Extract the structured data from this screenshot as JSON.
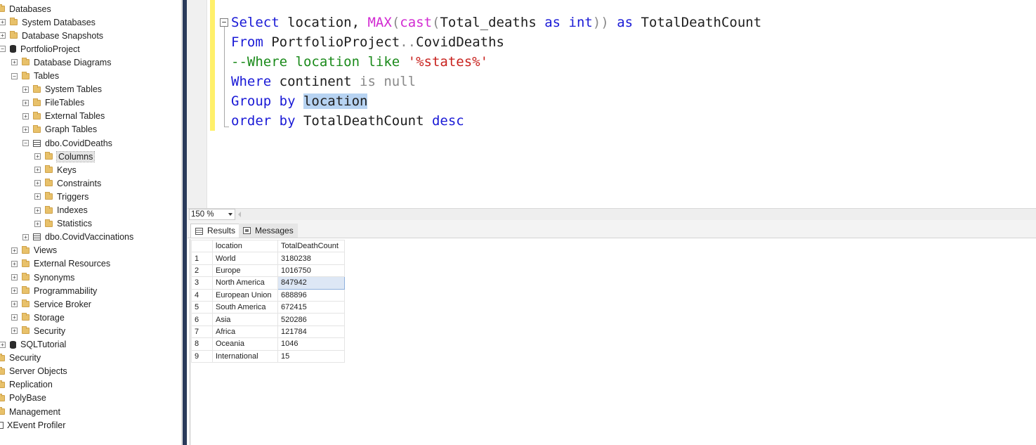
{
  "explorer": {
    "items": [
      {
        "label": "Databases",
        "icon": "folder-icon",
        "expander": ""
      },
      {
        "label": "System Databases",
        "icon": "folder-icon",
        "expander": "+"
      },
      {
        "label": "Database Snapshots",
        "icon": "folder-icon",
        "expander": "+"
      },
      {
        "label": "PortfolioProject",
        "icon": "database-icon",
        "expander": "−"
      },
      {
        "label": "Database Diagrams",
        "icon": "folder-icon",
        "expander": "+"
      },
      {
        "label": "Tables",
        "icon": "folder-icon",
        "expander": "−"
      },
      {
        "label": "System Tables",
        "icon": "folder-icon",
        "expander": "+"
      },
      {
        "label": "FileTables",
        "icon": "folder-icon",
        "expander": "+"
      },
      {
        "label": "External Tables",
        "icon": "folder-icon",
        "expander": "+"
      },
      {
        "label": "Graph Tables",
        "icon": "folder-icon",
        "expander": "+"
      },
      {
        "label": "dbo.CovidDeaths",
        "icon": "table-icon",
        "expander": "−"
      },
      {
        "label": "Columns",
        "icon": "folder-icon",
        "expander": "+"
      },
      {
        "label": "Keys",
        "icon": "folder-icon",
        "expander": "+"
      },
      {
        "label": "Constraints",
        "icon": "folder-icon",
        "expander": "+"
      },
      {
        "label": "Triggers",
        "icon": "folder-icon",
        "expander": "+"
      },
      {
        "label": "Indexes",
        "icon": "folder-icon",
        "expander": "+"
      },
      {
        "label": "Statistics",
        "icon": "folder-icon",
        "expander": "+"
      },
      {
        "label": "dbo.CovidVaccinations",
        "icon": "table-icon",
        "expander": "+"
      },
      {
        "label": "Views",
        "icon": "folder-icon",
        "expander": "+"
      },
      {
        "label": "External Resources",
        "icon": "folder-icon",
        "expander": "+"
      },
      {
        "label": "Synonyms",
        "icon": "folder-icon",
        "expander": "+"
      },
      {
        "label": "Programmability",
        "icon": "folder-icon",
        "expander": "+"
      },
      {
        "label": "Service Broker",
        "icon": "folder-icon",
        "expander": "+"
      },
      {
        "label": "Storage",
        "icon": "folder-icon",
        "expander": "+"
      },
      {
        "label": "Security",
        "icon": "folder-icon",
        "expander": "+"
      },
      {
        "label": "SQLTutorial",
        "icon": "database-icon",
        "expander": "+"
      },
      {
        "label": "Security",
        "icon": "folder-icon",
        "expander": ""
      },
      {
        "label": "Server Objects",
        "icon": "folder-icon",
        "expander": ""
      },
      {
        "label": "Replication",
        "icon": "folder-icon",
        "expander": ""
      },
      {
        "label": "PolyBase",
        "icon": "folder-icon",
        "expander": ""
      },
      {
        "label": "Management",
        "icon": "folder-icon",
        "expander": ""
      },
      {
        "label": "XEvent Profiler",
        "icon": "xevent-icon",
        "expander": ""
      }
    ],
    "selected_label": "Columns"
  },
  "editor": {
    "line1": {
      "kw_select": "Select",
      "t1": " location, ",
      "fn_max": "MAX",
      "p1": "(",
      "fn_cast": "cast",
      "p2": "(",
      "t2": "Total_deaths ",
      "kw_as1": "as",
      "t3": " ",
      "kw_int": "int",
      "p3": "))",
      "t4": " ",
      "kw_as2": "as",
      "t5": " TotalDeathCount"
    },
    "line2": {
      "kw_from": "From",
      "t1": " PortfolioProject",
      "p1": "..",
      "t2": "CovidDeaths"
    },
    "line3": {
      "comment": "--Where location like ",
      "str": "'%states%'"
    },
    "line4": {
      "kw_where": "Where",
      "t1": " continent ",
      "g1": "is null"
    },
    "line5": {
      "kw_group": "Group by",
      "t1": " ",
      "selected": "location"
    },
    "line6": {
      "kw_order": "order by",
      "t1": " TotalDeathCount ",
      "kw_desc": "desc"
    },
    "collapse_glyph": "−"
  },
  "zoom": {
    "value": "150 %"
  },
  "tabs": {
    "results": "Results",
    "messages": "Messages"
  },
  "results": {
    "columns": [
      "location",
      "TotalDeathCount"
    ],
    "rows": [
      {
        "n": "1",
        "location": "World",
        "count": "3180238"
      },
      {
        "n": "2",
        "location": "Europe",
        "count": "1016750"
      },
      {
        "n": "3",
        "location": "North America",
        "count": "847942"
      },
      {
        "n": "4",
        "location": "European Union",
        "count": "688896"
      },
      {
        "n": "5",
        "location": "South America",
        "count": "672415"
      },
      {
        "n": "6",
        "location": "Asia",
        "count": "520286"
      },
      {
        "n": "7",
        "location": "Africa",
        "count": "121784"
      },
      {
        "n": "8",
        "location": "Oceania",
        "count": "1046"
      },
      {
        "n": "9",
        "location": "International",
        "count": "15"
      }
    ],
    "selected_row": 3
  }
}
